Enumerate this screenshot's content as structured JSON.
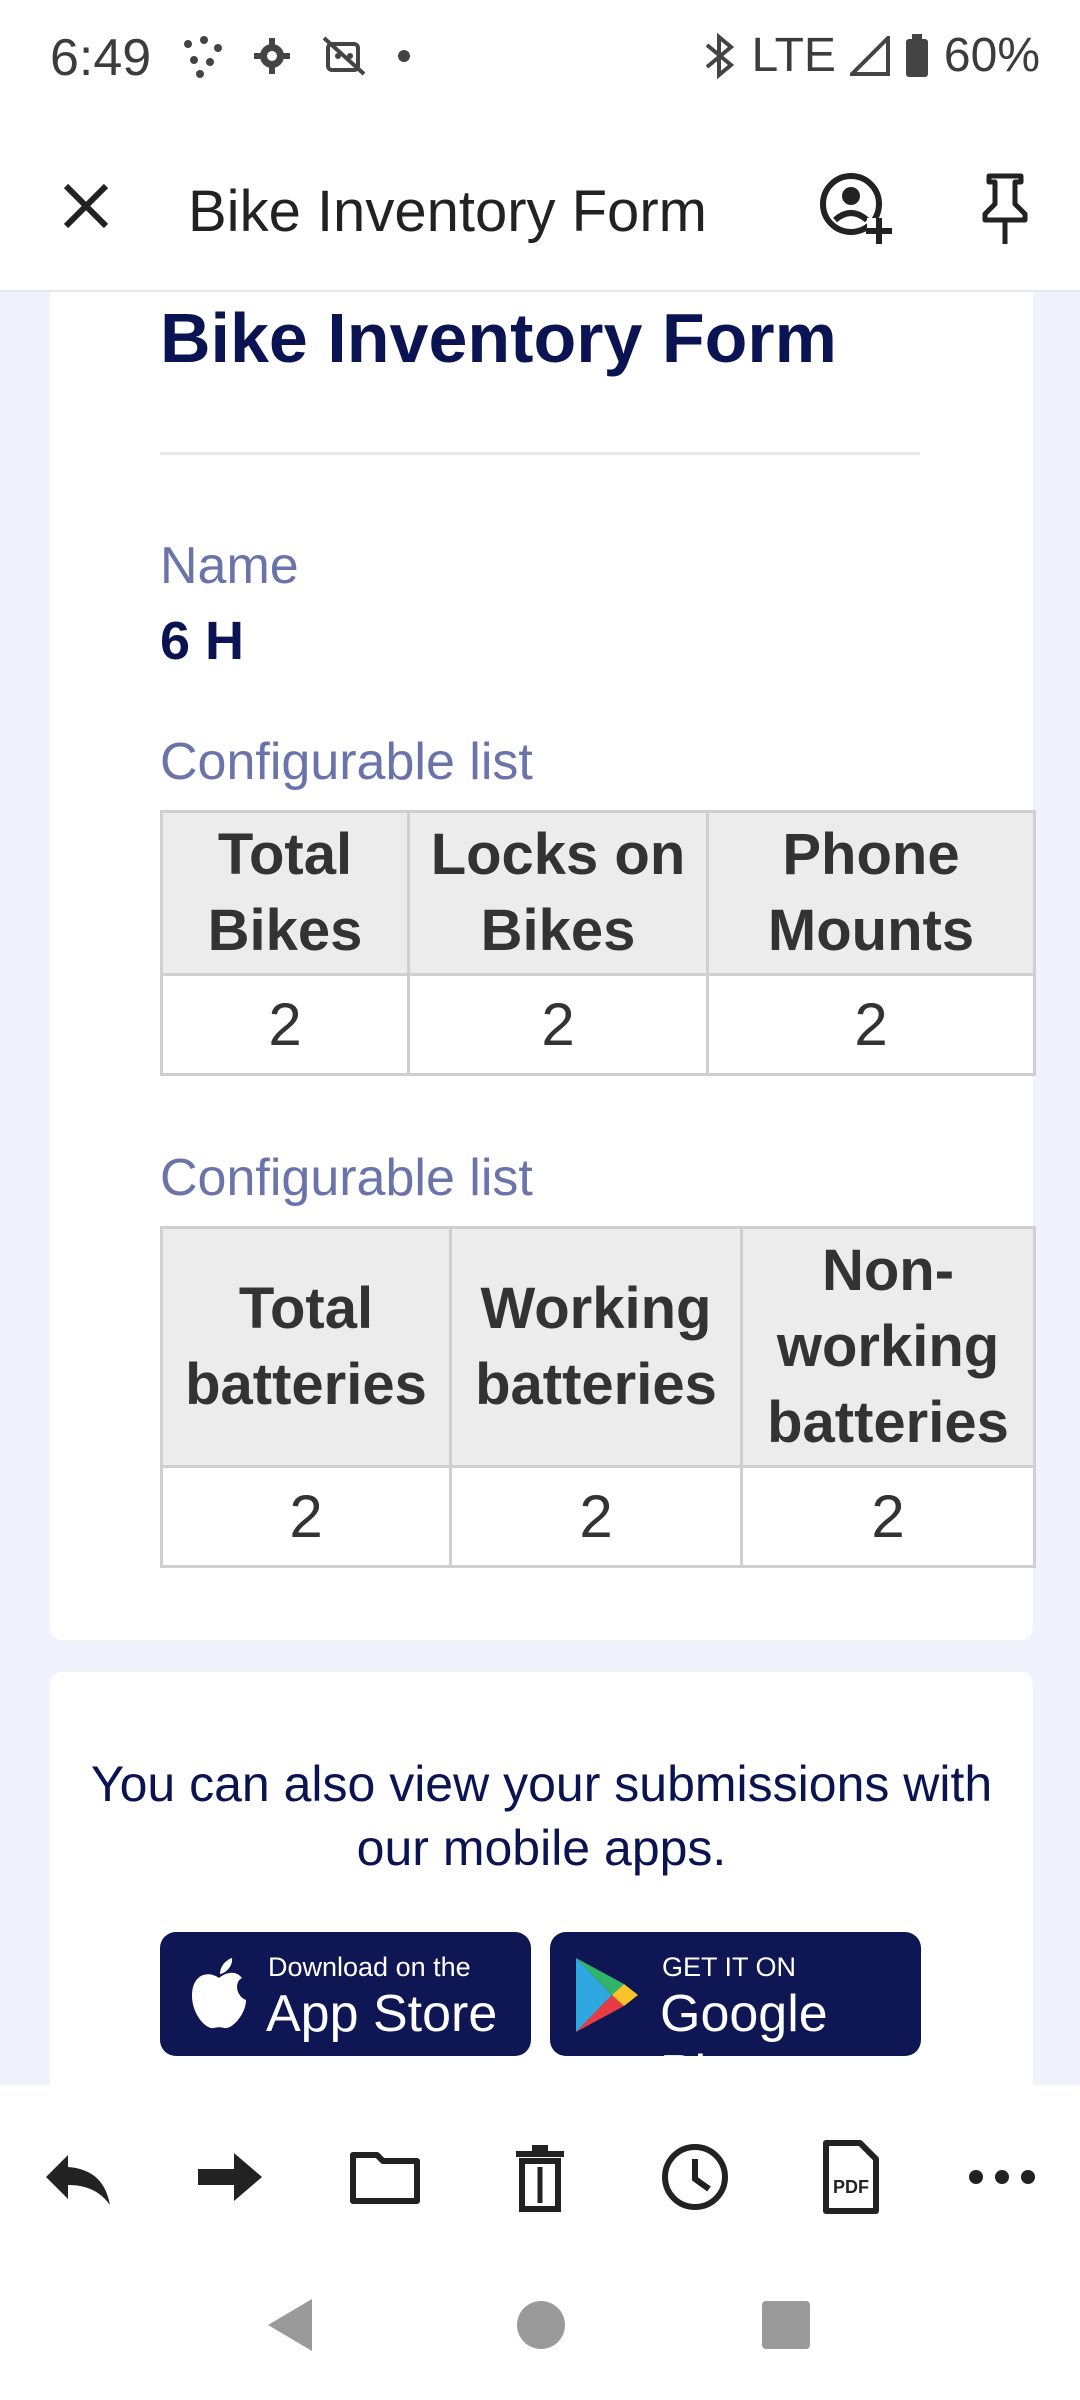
{
  "status_bar": {
    "time": "6:49",
    "network": "LTE",
    "battery": "60%"
  },
  "app_bar": {
    "title": "Bike Inventory Form"
  },
  "form": {
    "heading": "Bike Inventory Form",
    "name_label": "Name",
    "name_value": "6 H",
    "list1": {
      "label": "Configurable list",
      "headers": [
        "Total Bikes",
        "Locks on Bikes",
        "Phone Mounts"
      ],
      "values": [
        "2",
        "2",
        "2"
      ]
    },
    "list2": {
      "label": "Configurable list",
      "headers": [
        "Total batteries",
        "Working batteries",
        "Non-working batteries"
      ],
      "values": [
        "2",
        "2",
        "2"
      ]
    }
  },
  "promo": {
    "text": "You can also view your submissions with our mobile apps.",
    "app_store": {
      "small": "Download on the",
      "big": "App Store"
    },
    "google_play": {
      "small": "GET IT ON",
      "big": "Google Play"
    }
  },
  "colors": {
    "accent_navy": "#0b1452",
    "label_blue": "#6a73aa",
    "page_bg": "#f1f2fb"
  }
}
